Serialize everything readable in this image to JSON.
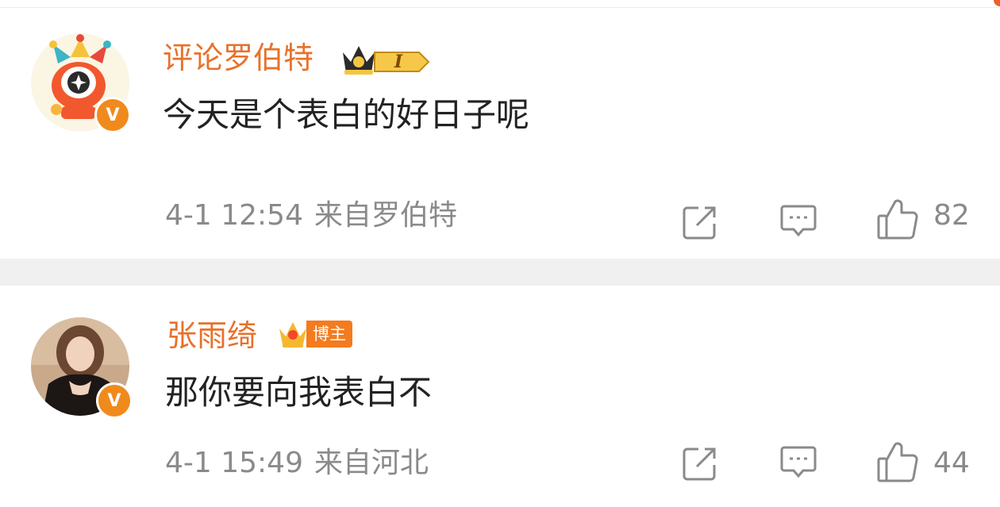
{
  "comments": [
    {
      "username": "评论罗伯特",
      "text": "今天是个表白的好日子呢",
      "time": "4-1 12:54",
      "source": "来自罗伯特",
      "like_count": "82",
      "level_badge": "I",
      "verified_badge": "V"
    },
    {
      "username": "张雨绮",
      "text": "那你要向我表白不",
      "time": "4-1 15:49",
      "source": "来自河北",
      "like_count": "44",
      "role_badge": "博主",
      "verified_badge": "V"
    }
  ],
  "colors": {
    "username": "#e8712b",
    "text": "#222222",
    "meta": "#8a8a8a",
    "separator": "#f0f0f0",
    "verified": "#f08a1c"
  },
  "icons": {
    "share": "share-icon",
    "comment": "comment-icon",
    "like": "like-icon"
  }
}
